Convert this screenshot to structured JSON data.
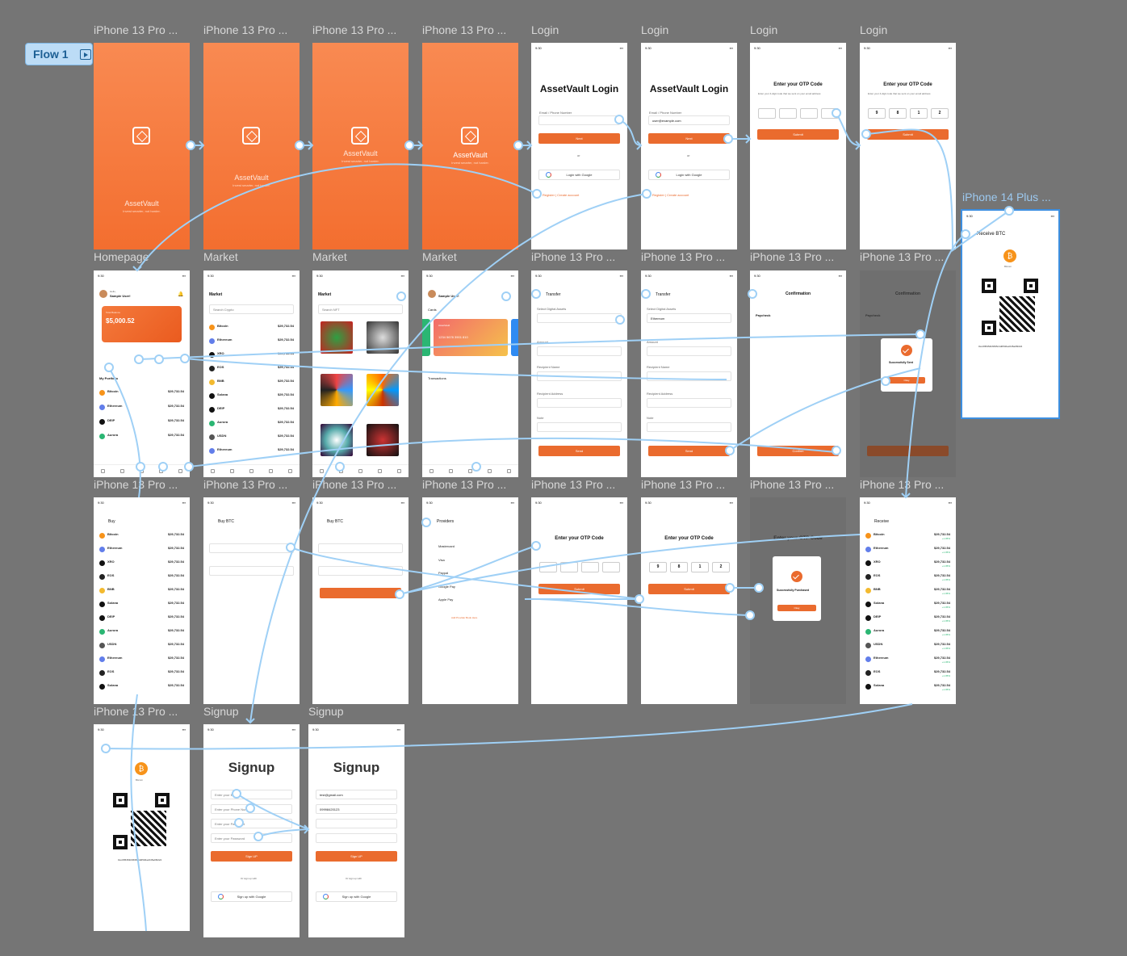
{
  "flow_badge": {
    "label": "Flow 1"
  },
  "frames": [
    {
      "id": "r1c1",
      "label": "iPhone 13 Pro ...",
      "kind": "splash1"
    },
    {
      "id": "r1c2",
      "label": "iPhone 13 Pro ...",
      "kind": "splash2"
    },
    {
      "id": "r1c3",
      "label": "iPhone 13 Pro ...",
      "kind": "splash3"
    },
    {
      "id": "r1c4",
      "label": "iPhone 13 Pro ...",
      "kind": "splash4"
    },
    {
      "id": "r1c5",
      "label": "Login",
      "kind": "login"
    },
    {
      "id": "r1c6",
      "label": "Login",
      "kind": "login-filled"
    },
    {
      "id": "r1c7",
      "label": "Login",
      "kind": "otp"
    },
    {
      "id": "r1c8",
      "label": "Login",
      "kind": "otp-filled"
    },
    {
      "id": "side",
      "label": "iPhone 14 Plus ...",
      "kind": "receive-qr-side"
    },
    {
      "id": "r2c1",
      "label": "Homepage",
      "kind": "home"
    },
    {
      "id": "r2c2",
      "label": "Market",
      "kind": "market"
    },
    {
      "id": "r2c3",
      "label": "Market",
      "kind": "market-nft"
    },
    {
      "id": "r2c4",
      "label": "Market",
      "kind": "cards"
    },
    {
      "id": "r2c5",
      "label": "iPhone 13 Pro ...",
      "kind": "transfer"
    },
    {
      "id": "r2c6",
      "label": "iPhone 13 Pro ...",
      "kind": "transfer-filled"
    },
    {
      "id": "r2c7",
      "label": "iPhone 13 Pro ...",
      "kind": "confirmation"
    },
    {
      "id": "r2c8",
      "label": "iPhone 13 Pro ...",
      "kind": "confirmation-success"
    },
    {
      "id": "r3c1",
      "label": "iPhone 13 Pro ...",
      "kind": "buy"
    },
    {
      "id": "r3c2",
      "label": "iPhone 13 Pro ...",
      "kind": "buy-btc"
    },
    {
      "id": "r3c3",
      "label": "iPhone 13 Pro ...",
      "kind": "buy-btc-filled"
    },
    {
      "id": "r3c4",
      "label": "iPhone 13 Pro ...",
      "kind": "providers"
    },
    {
      "id": "r3c5",
      "label": "iPhone 13 Pro ...",
      "kind": "otp2"
    },
    {
      "id": "r3c6",
      "label": "iPhone 13 Pro ...",
      "kind": "otp2-filled"
    },
    {
      "id": "r3c7",
      "label": "iPhone 13 Pro ...",
      "kind": "purchase-success"
    },
    {
      "id": "r3c8",
      "label": "iPhone 13 Pro ...",
      "kind": "receive"
    },
    {
      "id": "r4c1",
      "label": "iPhone 13 Pro ...",
      "kind": "receive-qr"
    },
    {
      "id": "r4c2",
      "label": "Signup",
      "kind": "signup"
    },
    {
      "id": "r4c3",
      "label": "Signup",
      "kind": "signup-filled"
    }
  ],
  "text": {
    "time": "9:30",
    "brand": "AssetVault",
    "tagline": "Invest smarter, not harder.",
    "login_title": "AssetVault Login",
    "email_label": "Email / Phone Number",
    "email_value": "user@example.com",
    "next": "Next",
    "or": "or",
    "google_login": "Login with Google",
    "register": "Register   |   Create account",
    "otp_title": "Enter your OTP Code",
    "otp_desc": "Enter your 4-digit code that we sent on your email address",
    "submit": "Submit",
    "otp_digits": [
      "9",
      "8",
      "1",
      "2"
    ],
    "receive_btc": "Receive BTC",
    "bitcoin": "Bitcoin",
    "wallet_addr": "0xcc8f6354b6695c4d0546ac045a06f224",
    "hi": "Hello,",
    "user": "Sample User!",
    "balance_label": "Total Balance",
    "balance": "$5,000.52",
    "portfolio": "My Portfolio",
    "market": "Market",
    "search_crypto": "Search Crypto",
    "search_nft": "Search NFT",
    "transfer": "Transfer",
    "select_assets": "Select Digital Assets",
    "amount": "Amount",
    "recipient_name": "Recipient Name",
    "recipient_address": "Recipient Address",
    "note": "Note",
    "send": "Send",
    "confirmation": "Confirmation",
    "paycheck": "Paycheck",
    "confirm": "Confirm",
    "success_sent": "Successfully Sent",
    "okay": "Okay",
    "buy": "Buy",
    "buy_btc": "Buy BTC",
    "providers": "Providers",
    "success_purchase": "Successfully Purchased",
    "receive": "Receive",
    "signup_title": "Signup",
    "sign_up": "Sign UP",
    "or_signup": "Or sign up with",
    "google_signup": "Sign up with Google",
    "email_ph": "Enter your Email",
    "phone_ph": "Enter your Phone Number",
    "pw_ph": "Enter your Password",
    "signup_email": "test@gmail.com",
    "signup_phone": "09998420123",
    "cards": "Cards",
    "transactions": "Transactions",
    "card_number": "1234  5678  3901  810",
    "card_name": "AssetVault",
    "provider_list": [
      "Mastercard",
      "Visa",
      "Paypal",
      "Google Pay",
      "Apple Pay"
    ],
    "add_provider": "Add Provider Book Here",
    "price": "$29,732.54",
    "change": "+1.05%"
  },
  "coins": [
    "Bitcoin",
    "Ethereum",
    "XRO",
    "EOS",
    "BNB",
    "Solana",
    "DEIP",
    "Aurora",
    "USDN",
    "Ethereum",
    "EOS",
    "Solana"
  ],
  "colors": {
    "canvas": "#757575",
    "accent": "#ea6b2e",
    "wire": "#9fd0f6",
    "label": "#d8d8d8"
  }
}
